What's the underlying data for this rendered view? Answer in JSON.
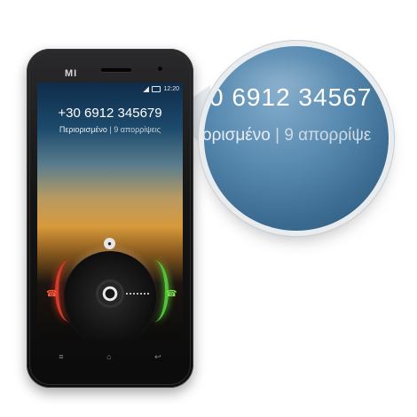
{
  "phone": {
    "brand": "MI",
    "status_time": "12:20"
  },
  "call": {
    "number": "+30 6912 345679",
    "status": "Περιορισμένο",
    "separator": "|",
    "rejections": "9 απορρίψεις"
  },
  "magnifier": {
    "number": "0 6912 34567",
    "status": "ορισμένο",
    "separator": "|",
    "rejections": "9 απορρίψε"
  },
  "navbar": {
    "menu_icon": "≡",
    "home_icon": "⌂",
    "back_icon": "↩"
  },
  "colors": {
    "decline": "#d23a2a",
    "accept": "#52c23a"
  }
}
